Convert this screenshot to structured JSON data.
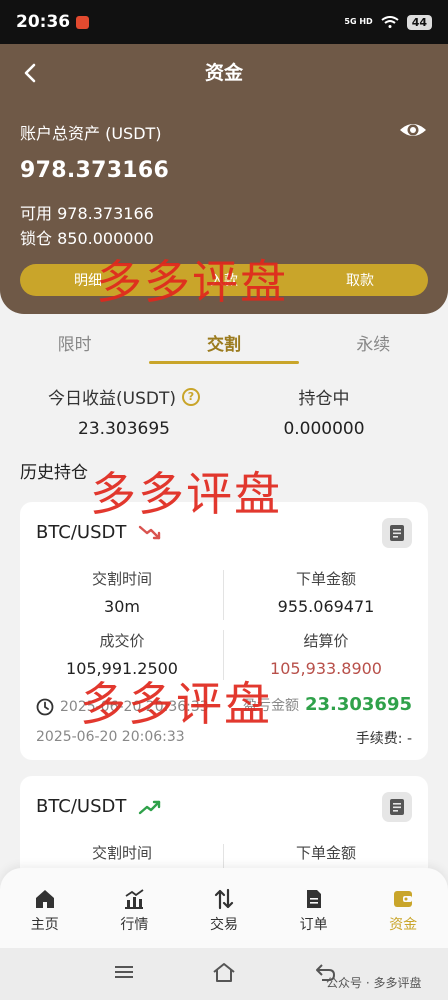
{
  "status": {
    "time": "20:36",
    "net_top": "5G HD",
    "net_bottom": "",
    "battery": "44"
  },
  "header": {
    "title": "资金",
    "total_label": "账户总资产 (USDT)",
    "total_value": "978.373166",
    "available_label": "可用",
    "available_value": "978.373166",
    "locked_label": "锁仓",
    "locked_value": "850.000000",
    "buttons": [
      "明细",
      "入款",
      "取款"
    ]
  },
  "tabs": [
    {
      "label": "限时",
      "active": false
    },
    {
      "label": "交割",
      "active": true
    },
    {
      "label": "永续",
      "active": false
    }
  ],
  "stats": {
    "today_label": "今日收益(USDT)",
    "today_value": "23.303695",
    "holding_label": "持仓中",
    "holding_value": "0.000000"
  },
  "history_title": "历史持仓",
  "positions": [
    {
      "pair": "BTC/USDT",
      "trend": "down",
      "delivery_time_label": "交割时间",
      "delivery_time": "30m",
      "order_amount_label": "下单金额",
      "order_amount": "955.069471",
      "deal_price_label": "成交价",
      "deal_price": "105,991.2500",
      "settle_price_label": "结算价",
      "settle_price": "105,933.8900",
      "open_time": "2025-06-20 20:36:33",
      "close_time": "2025-06-20 20:06:33",
      "pnl_label": "盈亏金额",
      "pnl_value": "23.303695",
      "fee_label": "手续费:",
      "fee_value": "-"
    },
    {
      "pair": "BTC/USDT",
      "trend": "up",
      "delivery_time_label": "交割时间",
      "order_amount_label": "下单金额"
    }
  ],
  "nav": [
    {
      "label": "主页",
      "icon": "home-icon",
      "active": false
    },
    {
      "label": "行情",
      "icon": "chart-icon",
      "active": false
    },
    {
      "label": "交易",
      "icon": "swap-icon",
      "active": false
    },
    {
      "label": "订单",
      "icon": "document-icon",
      "active": false
    },
    {
      "label": "资金",
      "icon": "wallet-icon",
      "active": true
    }
  ],
  "watermark_text": "多多评盘",
  "footer_watermark": "公众号 · 多多评盘",
  "colors": {
    "header_bg": "#6f5947",
    "accent": "#c9a52a",
    "profit": "#2fa14a",
    "settle": "#b8504a",
    "watermark": "#e0281d"
  }
}
